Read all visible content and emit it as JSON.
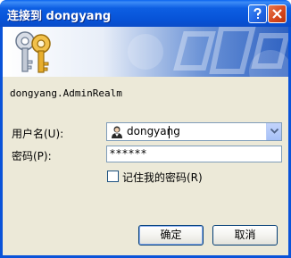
{
  "window": {
    "title": "连接到 dongyang"
  },
  "titlebar_buttons": {
    "help_icon": "help-question-icon",
    "close_icon": "close-x-icon"
  },
  "banner": {
    "icon": "keys-icon"
  },
  "realm": "dongyang.AdminRealm",
  "form": {
    "username_label": "用户名(U):",
    "username_value": "dongyang",
    "password_label": "密码(P):",
    "password_mask": "******",
    "remember_label": "记住我的密码(R)",
    "remember_checked": false
  },
  "buttons": {
    "ok": "确定",
    "cancel": "取消"
  },
  "colors": {
    "titlebar": "#0a53d9",
    "dialog_bg": "#ece9d8",
    "close_button": "#d5451b"
  }
}
